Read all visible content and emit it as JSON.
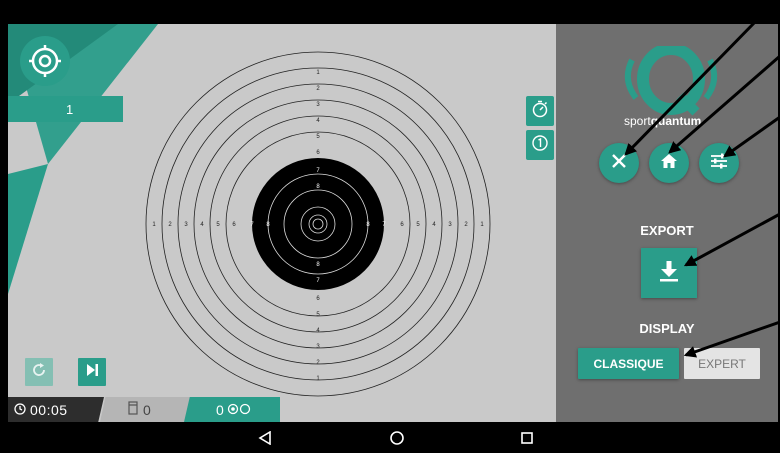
{
  "colors": {
    "accent": "#2a9d8a",
    "accent_light": "#84bfb3",
    "target_background": "#c9c9c9",
    "panel_background": "#6f6f6f",
    "arrow_color": "#000000"
  },
  "icons": {
    "logo": "crosshair-target-icon",
    "timer_button": "stopwatch-icon",
    "info_button": "circled-one-icon",
    "reload": "reload-icon",
    "play": "skip-forward-icon",
    "timer": "clock-icon",
    "count": "canister-icon",
    "shots": "target-small-icon",
    "close": "close-icon",
    "home": "home-icon",
    "settings": "sliders-icon",
    "export": "download-icon",
    "nav_back": "back-triangle-icon",
    "nav_home": "home-circle-icon",
    "nav_recent": "recent-square-icon"
  },
  "header": {
    "counter_value": "1"
  },
  "target": {
    "top_ring_labels": [
      "1",
      "2",
      "3",
      "4",
      "5",
      "6",
      "7",
      "8"
    ],
    "bottom_ring_labels": [
      "8",
      "7",
      "6",
      "5",
      "4",
      "3",
      "2",
      "1"
    ],
    "left_ring_labels": [
      "1",
      "2",
      "3",
      "4",
      "5",
      "6",
      "7",
      "8"
    ],
    "right_ring_labels": [
      "8",
      "7",
      "6",
      "5",
      "4",
      "3",
      "2",
      "1"
    ]
  },
  "status": {
    "timer": "00:05",
    "count": "0",
    "shots": "0"
  },
  "brand": {
    "prefix": "sport",
    "name": "quantum"
  },
  "panel": {
    "export_label": "EXPORT",
    "display_label": "DISPLAY",
    "classique_label": "CLASSIQUE",
    "expert_label": "EXPERT"
  }
}
